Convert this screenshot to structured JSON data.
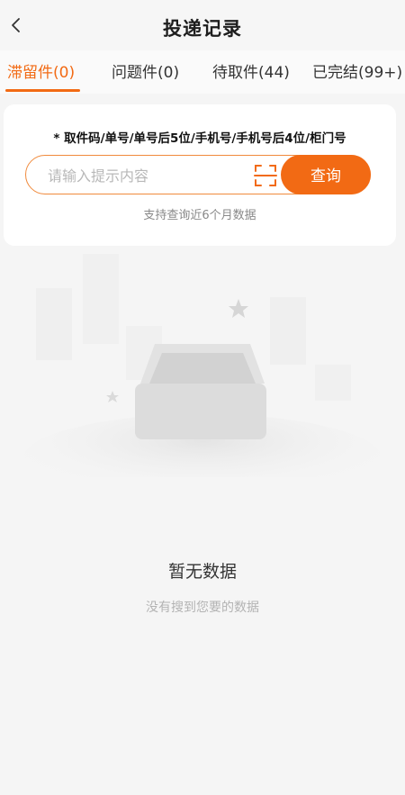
{
  "header": {
    "title": "投递记录",
    "back_icon": "chevron-left-icon"
  },
  "tabs": [
    {
      "label": "滞留件(0)",
      "active": true
    },
    {
      "label": "问题件(0)",
      "active": false
    },
    {
      "label": "待取件(44)",
      "active": false
    },
    {
      "label": "已完结(99+)",
      "active": false
    }
  ],
  "search": {
    "hint": "* 取件码/单号/单号后5位/手机号/手机号后4位/柜门号",
    "placeholder": "请输入提示内容",
    "value": "",
    "scan_icon": "scan-icon",
    "button_label": "查询",
    "support_text": "支持查询近6个月数据"
  },
  "empty_state": {
    "title": "暂无数据",
    "subtitle": "没有搜到您要的数据",
    "illustration": "empty-box-illustration"
  },
  "colors": {
    "accent": "#f26a14",
    "background": "#f5f5f5"
  }
}
